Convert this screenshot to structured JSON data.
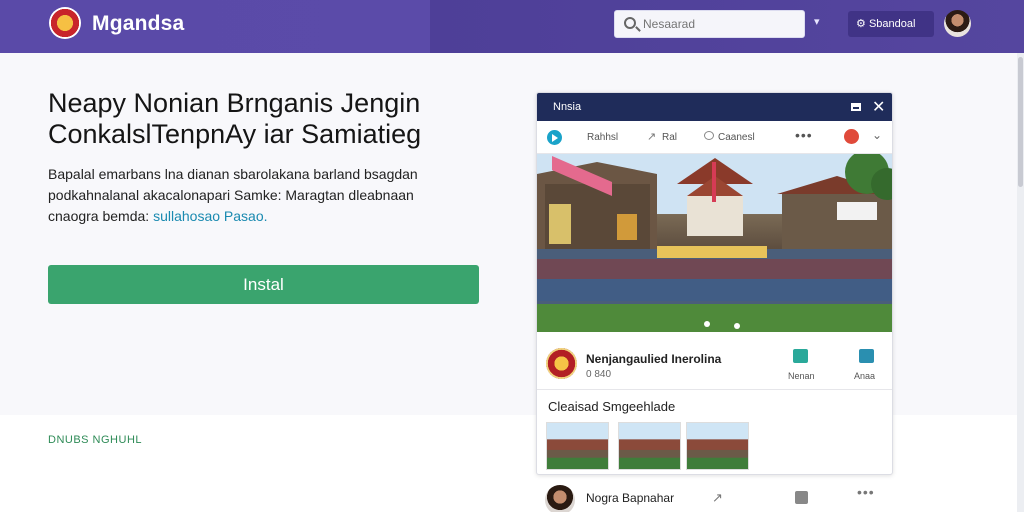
{
  "header": {
    "brand": "Mgandsa",
    "search_placeholder": "Nesaarad",
    "account_label": "Sbandoal"
  },
  "hero": {
    "headline": "Neapy Nonian Brnganis Jengin ConkalslTenpnAy iar Samiatieg",
    "description": "Bapalal emarbans lna dianan sbarolakana barland bsagdan podkahnalanal akacalonapari Samke: Maragtan dleabnaan cnaogra bemda:",
    "description_link": "sullahosao Pasao.",
    "install_label": "Instal",
    "footer_label": "DNUBS NGHUHL"
  },
  "card": {
    "title": "Nnsia",
    "toolbar": {
      "label1": "Rahhsl",
      "label2": "Ral",
      "label3": "Caanesl"
    },
    "page": {
      "name": "Nenjangaulied Inerolina",
      "sub": "0 840",
      "action1": "Nenan",
      "action2": "Anaa"
    },
    "related_title": "Cleaisad Smgeehlade"
  },
  "post": {
    "name": "Nogra Bapnahar"
  },
  "colors": {
    "topbar": "#5a4aa8",
    "install_button": "#3aa46e",
    "card_header": "#1f2c5a",
    "link": "#1a8ab0"
  },
  "icons": [
    "search-icon",
    "chevron-down-icon",
    "avatar",
    "close-icon",
    "minimize-icon",
    "play-icon",
    "share-icon",
    "chat-icon",
    "more-icon",
    "heart-icon"
  ]
}
